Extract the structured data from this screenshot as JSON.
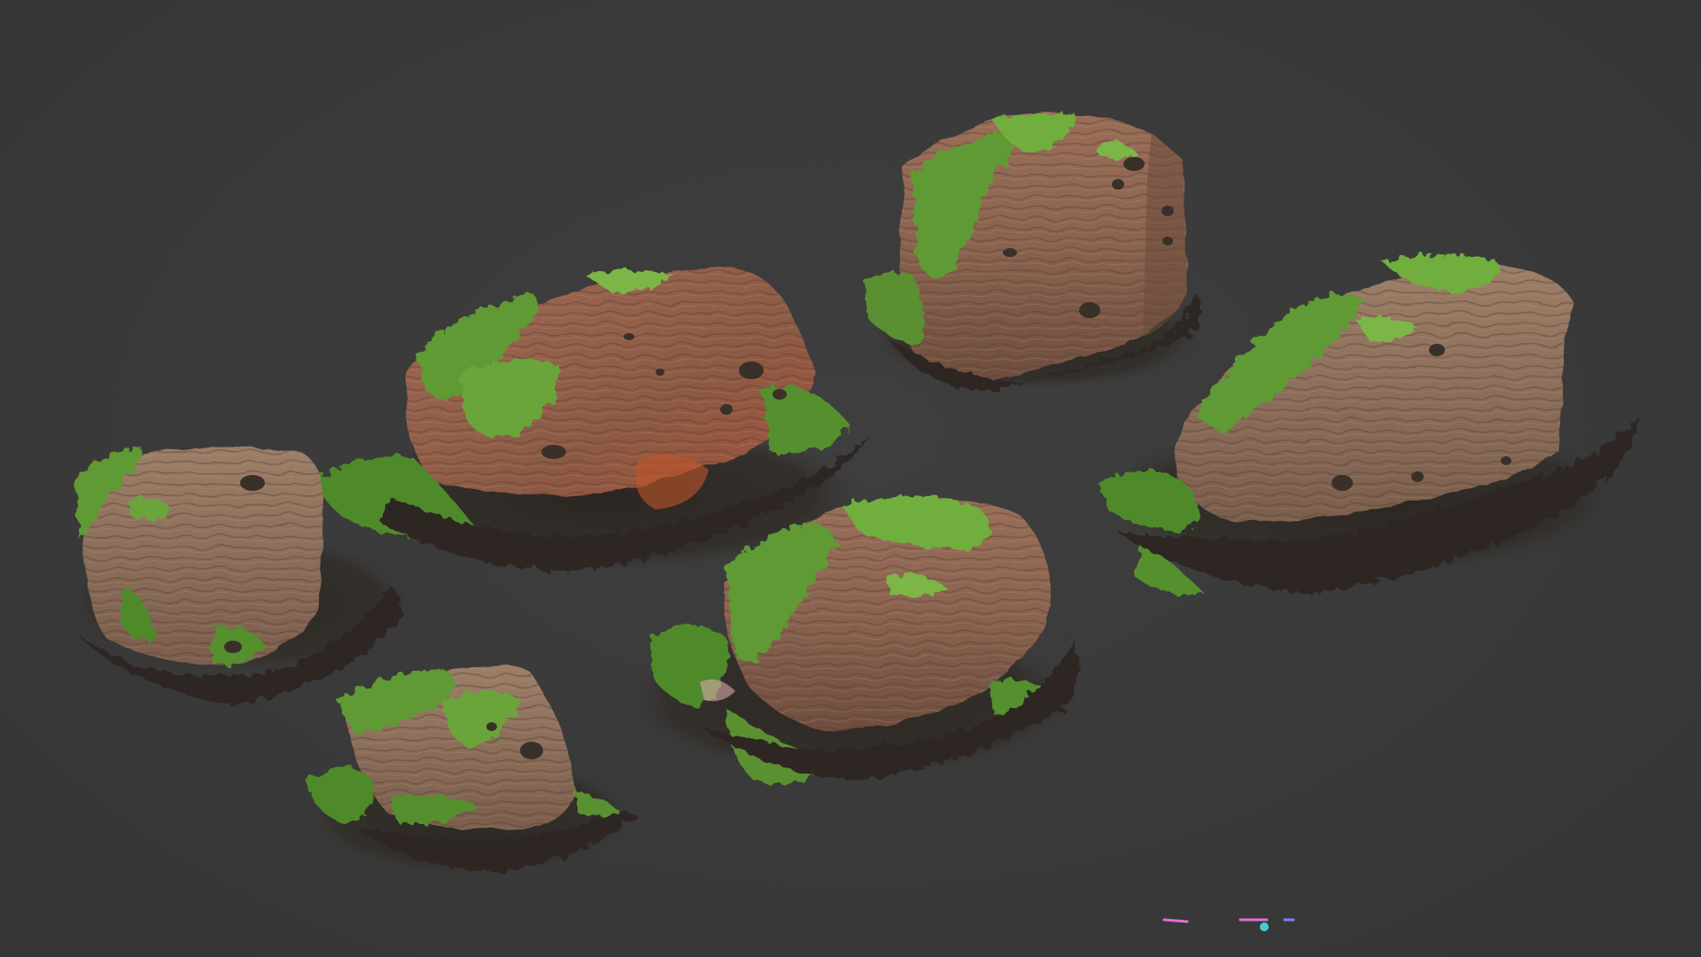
{
  "viewport": {
    "background_color": "#3a3a3a"
  },
  "scene": {
    "assets": [
      {
        "name": "rock-tall-top-center",
        "moss_coverage": "medium"
      },
      {
        "name": "rock-large-upper-left",
        "moss_coverage": "medium"
      },
      {
        "name": "rock-long-right",
        "moss_coverage": "medium"
      },
      {
        "name": "rock-round-left",
        "moss_coverage": "light"
      },
      {
        "name": "rock-center",
        "moss_coverage": "heavy"
      },
      {
        "name": "rock-small-bottom-left",
        "moss_coverage": "heavy"
      }
    ],
    "colors": {
      "rock_base": "#8a6350",
      "rock_light": "#a88468",
      "rock_dark": "#5c4034",
      "moss": "#5f9a35",
      "moss_light": "#7cb646",
      "ground": "#2c2622"
    }
  },
  "gizmo": {
    "icon": "axis-gizmo-icon",
    "colors": [
      "#e070d0",
      "#40d0d0",
      "#8080ff"
    ]
  }
}
